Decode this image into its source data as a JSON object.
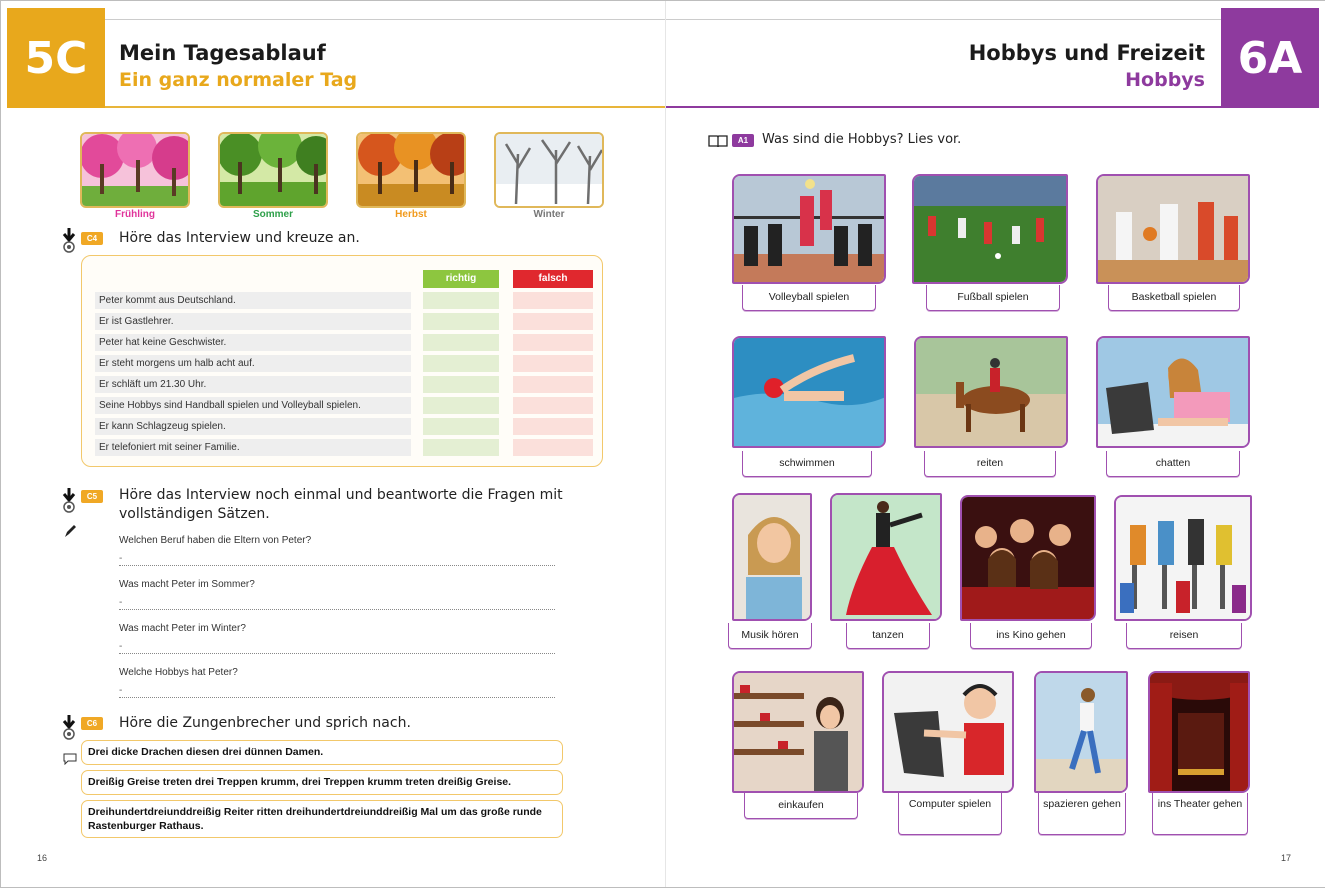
{
  "left_page": {
    "unit": "5C",
    "title": "Mein Tagesablauf",
    "subtitle": "Ein ganz normaler Tag",
    "seasons": [
      "Frühling",
      "Sommer",
      "Herbst",
      "Winter"
    ],
    "season_colors": [
      "#e0339a",
      "#2ea04a",
      "#f19a1c",
      "#777777"
    ],
    "c4": {
      "tag": "C4",
      "instruction": "Höre das Interview und kreuze an.",
      "col_true": "richtig",
      "col_false": "falsch",
      "rows": [
        "Peter kommt aus Deutschland.",
        "Er ist Gastlehrer.",
        "Peter hat keine Geschwister.",
        "Er steht morgens um halb acht auf.",
        "Er schläft um 21.30 Uhr.",
        "Seine Hobbys sind Handball spielen und Volleyball spielen.",
        "Er kann Schlagzeug spielen.",
        "Er telefoniert mit seiner Familie."
      ]
    },
    "c5": {
      "tag": "C5",
      "instruction_line1": "Höre das Interview noch einmal und beantworte die Fragen mit",
      "instruction_line2": "vollständigen Sätzen.",
      "questions": [
        "Welchen Beruf haben die Eltern von Peter?",
        "Was macht Peter im Sommer?",
        "Was macht Peter im Winter?",
        "Welche Hobbys hat Peter?"
      ],
      "answer_marker": "-"
    },
    "c6": {
      "tag": "C6",
      "instruction": "Höre die Zungenbrecher und sprich nach.",
      "twisters": [
        "Drei dicke Drachen diesen drei dünnen Damen.",
        "Dreißig Greise treten drei Treppen krumm, drei Treppen krumm treten dreißig Greise.",
        "Dreihundertdreiunddreißig Reiter ritten dreihundertdreiunddreißig Mal um das große runde Rastenburger Rathaus."
      ]
    },
    "page_number": "16"
  },
  "right_page": {
    "unit": "6A",
    "title": "Hobbys und Freizeit",
    "subtitle": "Hobbys",
    "a1": {
      "tag": "A1",
      "instruction": "Was sind die Hobbys? Lies vor."
    },
    "hobbies": [
      "Volleyball spielen",
      "Fußball spielen",
      "Basketball spielen",
      "schwimmen",
      "reiten",
      "chatten",
      "Musik hören",
      "tanzen",
      "ins Kino gehen",
      "reisen",
      "einkaufen",
      "Computer spielen",
      "spazieren gehen",
      "ins Theater gehen"
    ],
    "page_number": "17"
  },
  "colors": {
    "unit5_orange": "#e8a81c",
    "unit6_purple": "#8e3a9e",
    "richtig_green": "#8dc63f",
    "falsch_red": "#e0282e"
  }
}
